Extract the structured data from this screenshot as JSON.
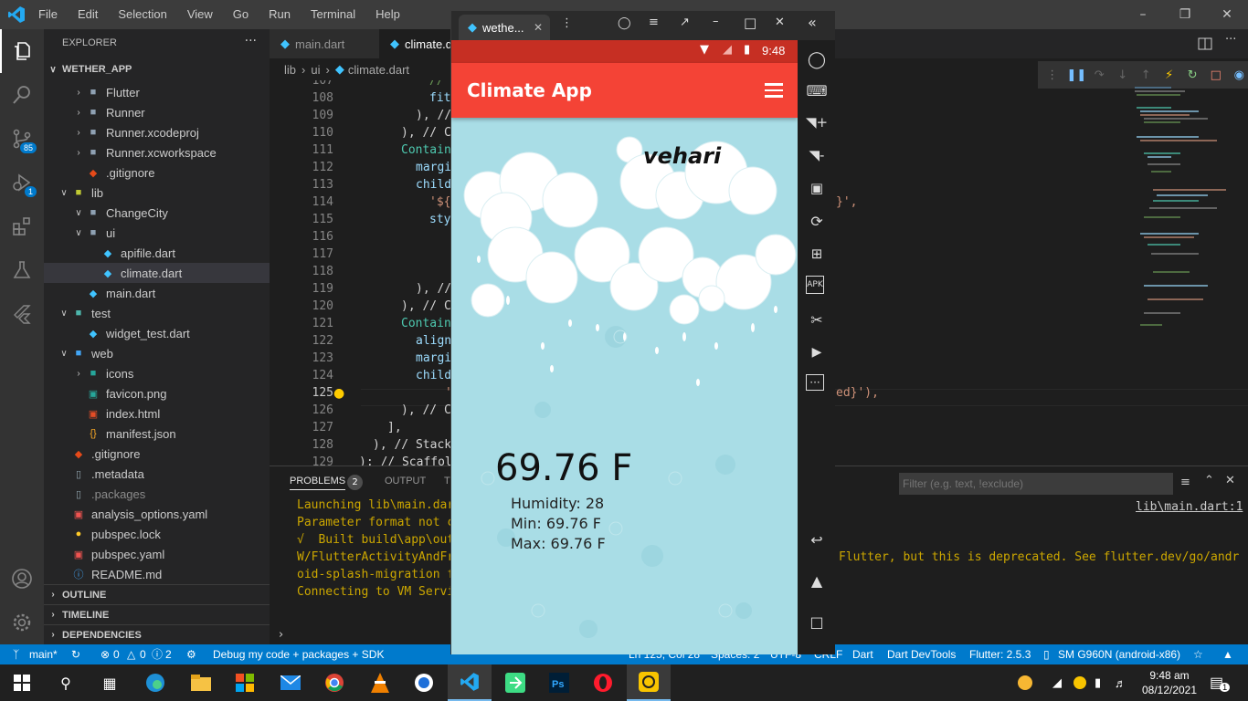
{
  "titlebar": {
    "menu": [
      "File",
      "Edit",
      "Selection",
      "View",
      "Go",
      "Run",
      "Terminal",
      "Help"
    ]
  },
  "activity": {
    "scm_badge": "85",
    "debug_badge": "1"
  },
  "explorer": {
    "title": "EXPLORER",
    "root": "WETHER_APP",
    "items": [
      {
        "label": "Flutter",
        "kind": "folder",
        "level": 1,
        "open": false
      },
      {
        "label": "Runner",
        "kind": "folder",
        "level": 1,
        "open": false
      },
      {
        "label": "Runner.xcodeproj",
        "kind": "folder",
        "level": 1,
        "open": false
      },
      {
        "label": "Runner.xcworkspace",
        "kind": "folder",
        "level": 1,
        "open": false
      },
      {
        "label": ".gitignore",
        "kind": "git",
        "level": 1
      },
      {
        "label": "lib",
        "kind": "folder-lib",
        "level": 0,
        "open": true
      },
      {
        "label": "ChangeCity",
        "kind": "folder",
        "level": 1,
        "open": true
      },
      {
        "label": "ui",
        "kind": "folder",
        "level": 1,
        "open": true
      },
      {
        "label": "apifile.dart",
        "kind": "dart",
        "level": 2
      },
      {
        "label": "climate.dart",
        "kind": "dart",
        "level": 2,
        "selected": true
      },
      {
        "label": "main.dart",
        "kind": "dart",
        "level": 1
      },
      {
        "label": "test",
        "kind": "folder-test",
        "level": 0,
        "open": true
      },
      {
        "label": "widget_test.dart",
        "kind": "dart",
        "level": 1
      },
      {
        "label": "web",
        "kind": "folder-web",
        "level": 0,
        "open": true
      },
      {
        "label": "icons",
        "kind": "folder-img",
        "level": 1,
        "open": false
      },
      {
        "label": "favicon.png",
        "kind": "image",
        "level": 1
      },
      {
        "label": "index.html",
        "kind": "html",
        "level": 1
      },
      {
        "label": "manifest.json",
        "kind": "json",
        "level": 1
      },
      {
        "label": ".gitignore",
        "kind": "git",
        "level": 0
      },
      {
        "label": ".metadata",
        "kind": "file",
        "level": 0
      },
      {
        "label": ".packages",
        "kind": "file",
        "level": 0,
        "dim": true
      },
      {
        "label": "analysis_options.yaml",
        "kind": "yaml",
        "level": 0
      },
      {
        "label": "pubspec.lock",
        "kind": "lock",
        "level": 0
      },
      {
        "label": "pubspec.yaml",
        "kind": "yaml",
        "level": 0
      },
      {
        "label": "README.md",
        "kind": "info",
        "level": 0
      }
    ],
    "sections": [
      "OUTLINE",
      "TIMELINE",
      "DEPENDENCIES"
    ]
  },
  "tabs": [
    {
      "label": "main.dart"
    },
    {
      "label": "climate.d"
    }
  ],
  "breadcrumb": [
    "lib",
    "ui",
    "climate.dart"
  ],
  "code": {
    "line_numbers": [
      "107",
      "108",
      "109",
      "110",
      "111",
      "112",
      "113",
      "114",
      "115",
      "116",
      "117",
      "118",
      "119",
      "120",
      "121",
      "122",
      "123",
      "124",
      "125",
      "126",
      "127",
      "128",
      "129"
    ],
    "current_line": "125",
    "fragments": [
      "//",
      "fit",
      "), //",
      "), // C",
      "Contain",
      "margi",
      "child",
      "'${",
      "sty",
      "), //",
      "), // C",
      "Contain",
      "align",
      "margi",
      "child",
      "'",
      "), // C",
      "],",
      "), // Stack",
      "); // Scaffol"
    ],
    "right_fragments": [
      "}',",
      "ed}'),"
    ]
  },
  "panel": {
    "tabs": [
      "PROBLEMS",
      "OUTPUT",
      "T"
    ],
    "problems_count": "2",
    "filter_placeholder": "Filter (e.g. text, !exclude)",
    "source_link": "lib\\main.dart:1",
    "lines": [
      "Launching lib\\main.dar",
      "Parameter format not c",
      "√  Built build\\app\\out",
      "W/FlutterActivityAndFr",
      "oid-splash-migration f",
      "Connecting to VM Servi"
    ],
    "line4_tail": "Flutter, but this is deprecated. See flutter.dev/go/andr"
  },
  "statusbar": {
    "branch": "main*",
    "errors": "0",
    "warnings": "0",
    "infos": "2",
    "debug": "Debug my code + packages + SDK",
    "position": "Ln 125, Col 28",
    "spaces": "Spaces: 2",
    "encoding": "UTF-8",
    "eol": "CRLF",
    "language": "Dart",
    "devtools": "Dart DevTools",
    "flutter": "Flutter: 2.5.3",
    "device": "SM G960N (android-x86)"
  },
  "emulator": {
    "tab_title": "wethe...",
    "phone_time": "9:48",
    "app_title": "Climate App",
    "city": "vehari",
    "temperature": "69.76 F",
    "humidity": "Humidity: 28",
    "min": "Min: 69.76 F",
    "max": "Max: 69.76 F"
  },
  "taskbar": {
    "time": "9:48 am",
    "date": "08/12/2021",
    "notification_count": "1"
  },
  "colors": {
    "accent": "#007acc",
    "appbar": "#f44336",
    "phone_status": "#c62f23",
    "sky": "#a9dde6"
  }
}
